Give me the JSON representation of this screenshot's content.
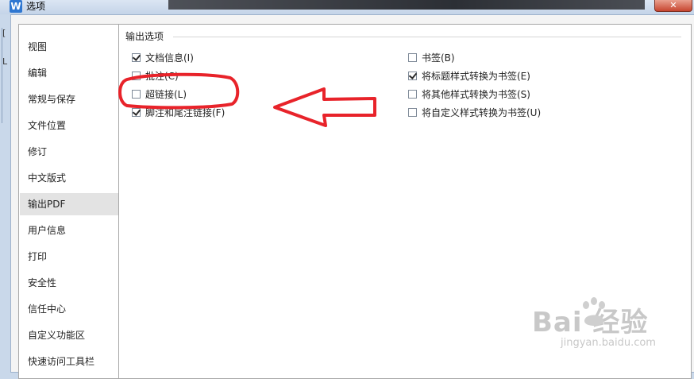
{
  "window": {
    "title": "选项",
    "logo_letter": "W",
    "close_glyph": "✕",
    "left_edge_chars": [
      "[",
      "L"
    ]
  },
  "nav": {
    "selected": "输出PDF",
    "items": [
      "视图",
      "编辑",
      "常规与保存",
      "文件位置",
      "修订",
      "中文版式",
      "输出PDF",
      "用户信息",
      "打印",
      "安全性",
      "信任中心",
      "自定义功能区",
      "快速访问工具栏"
    ]
  },
  "panel": {
    "section_title": "输出选项",
    "left_options": [
      {
        "label": "文档信息(I)",
        "checked": true
      },
      {
        "label": "批注(C)",
        "checked": false
      },
      {
        "label": "超链接(L)",
        "checked": false
      },
      {
        "label": "脚注和尾注链接(F)",
        "checked": true
      }
    ],
    "right_options": [
      {
        "label": "书签(B)",
        "checked": false
      },
      {
        "label": "将标题样式转换为书签(E)",
        "checked": true
      },
      {
        "label": "将其他样式转换为书签(S)",
        "checked": false
      },
      {
        "label": "将自定义样式转换为书签(U)",
        "checked": false
      }
    ]
  },
  "annotation": {
    "color": "#e8232a",
    "shapes": [
      "rounded-rect-highlight",
      "left-arrow"
    ]
  },
  "watermark": {
    "brand": "Bai  经验",
    "url": "jingyan.baidu.com",
    "icon": "paw-icon",
    "color": "#c8c8c8"
  }
}
